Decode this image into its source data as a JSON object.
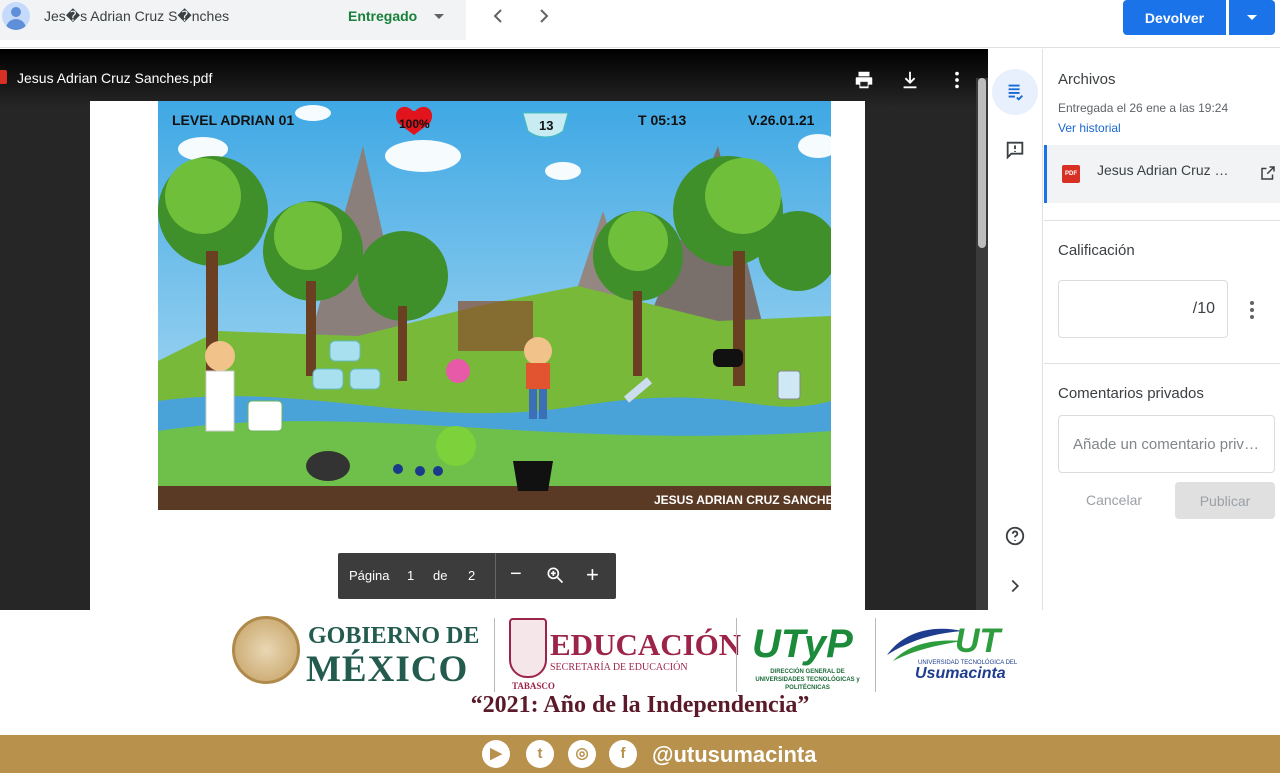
{
  "topbar": {
    "student_name": "Jes�s Adrian Cruz S�nches",
    "status": "Entregado",
    "prev_icon": "chevron-left-icon",
    "next_icon": "chevron-right-icon",
    "return_label": "Devolver"
  },
  "viewer": {
    "file_title": "Jesus Adrian Cruz Sanches.pdf",
    "tools": [
      "print-icon",
      "download-icon",
      "more-vert-icon"
    ],
    "game": {
      "level": "LEVEL ADRIAN 01",
      "health": "100%",
      "masks": "13",
      "time": "T 05:13",
      "version": "V.26.01.21",
      "author": "JESUS ADRIAN CRUZ SANCHES"
    },
    "pager": {
      "page_label": "Página",
      "current": "1",
      "of_label": "de",
      "total": "2",
      "zoom_out": "−",
      "zoom_in": "+"
    }
  },
  "rail": {
    "icons": [
      "assignment-icon",
      "feedback-icon",
      "help-icon",
      "expand-icon"
    ]
  },
  "panel": {
    "files_title": "Archivos",
    "submitted": "Entregada el 26 ene a las 19:24",
    "history_link": "Ver historial",
    "file_name": "Jesus Adrian Cruz Sanches.pdf",
    "file_badge": "PDF",
    "grade_title": "Calificación",
    "grade_denominator": "/10",
    "comments_title": "Comentarios privados",
    "comment_placeholder": "Añade un comentario privado",
    "cancel_label": "Cancelar",
    "publish_label": "Publicar"
  },
  "footer": {
    "gob_line1": "GOBIERNO DE",
    "gob_line2": "MÉXICO",
    "edu": "EDUCACIÓN",
    "edu_sub": "SECRETARÍA DE EDUCACIÓN",
    "state": "TABASCO",
    "utp": "UTyP",
    "utp_sub": "DIRECCIÓN GENERAL DE UNIVERSIDADES TECNOLÓGICAS y POLITÉCNICAS",
    "ut": "UT",
    "ut_sub": "UNIVERSIDAD TECNOLÓGICA DEL",
    "ut_name": "Usumacinta",
    "motto": "“2021: Año de la Independencia”",
    "handle": "@utusumacinta",
    "social": [
      "youtube-icon",
      "twitter-icon",
      "instagram-icon",
      "facebook-icon"
    ]
  }
}
